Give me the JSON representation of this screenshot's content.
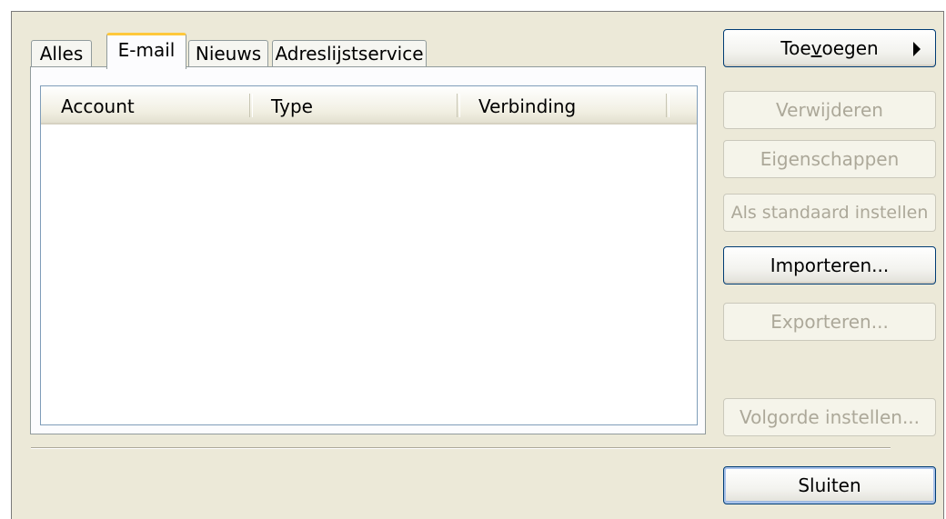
{
  "tabs": [
    {
      "label": "Alles",
      "active": false
    },
    {
      "label": "E-mail",
      "active": true
    },
    {
      "label": "Nieuws",
      "active": false
    },
    {
      "label": "Adreslijstservice",
      "active": false
    }
  ],
  "list": {
    "columns": [
      "Account",
      "Type",
      "Verbinding"
    ],
    "rows": []
  },
  "buttons": {
    "add": {
      "pre": "Toe",
      "mnemonic": "v",
      "post": "oegen",
      "enabled": true
    },
    "remove": {
      "label": "Verwijderen",
      "enabled": false
    },
    "properties": {
      "label": "Eigenschappen",
      "enabled": false
    },
    "set_default": {
      "label": "Als standaard instellen",
      "enabled": false
    },
    "import": {
      "label": "Importeren...",
      "enabled": true
    },
    "export": {
      "label": "Exporteren...",
      "enabled": false
    },
    "set_order": {
      "label": "Volgorde instellen...",
      "enabled": false
    },
    "close": {
      "label": "Sluiten",
      "enabled": true
    }
  },
  "icons": {
    "add_menu": "triangle-right-icon"
  }
}
